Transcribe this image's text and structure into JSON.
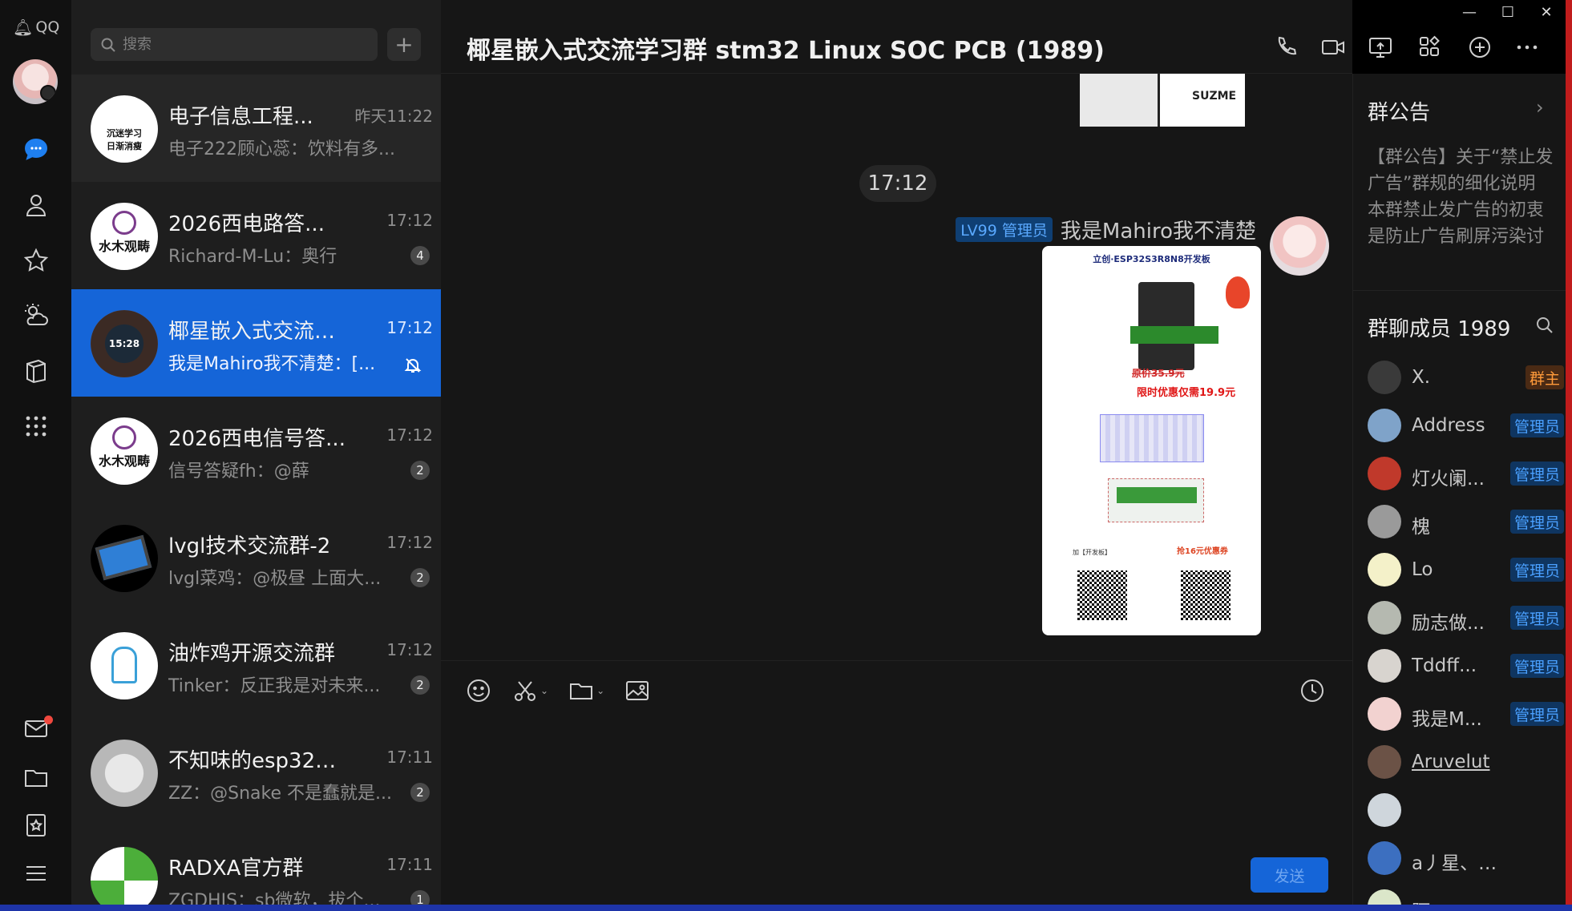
{
  "app": {
    "logo_text": "QQ"
  },
  "search": {
    "placeholder": "搜索"
  },
  "add_button": "+",
  "conversations": [
    {
      "name": "电子信息工程...",
      "time": "昨天11:22",
      "msg": "电子222顾心蕊：饮料有多...",
      "badge": "",
      "avatar_text": "沉迷学习\n日渐消瘦"
    },
    {
      "name": "2026西电路答...",
      "time": "17:12",
      "msg": "Richard-M-Lu：奥行",
      "badge": "4",
      "avatar_text": "水木观畴"
    },
    {
      "name": "椰星嵌入式交流学...",
      "time": "17:12",
      "msg": "我是Mahiro我不清楚：[...",
      "badge": "",
      "avatar_text": "15:28"
    },
    {
      "name": "2026西电信号答...",
      "time": "17:12",
      "msg": "信号答疑fh：@薛",
      "badge": "2",
      "avatar_text": "水木观畴"
    },
    {
      "name": "lvgl技术交流群-2",
      "time": "17:12",
      "msg": "lvgl菜鸡：@极昼 上面大...",
      "badge": "2",
      "avatar_text": ""
    },
    {
      "name": "油炸鸡开源交流群",
      "time": "17:12",
      "msg": "Tinker：反正我是对未来...",
      "badge": "2",
      "avatar_text": ""
    },
    {
      "name": "不知味的esp32唠...",
      "time": "17:11",
      "msg": "ZZ：@Snake 不是蠢就是...",
      "badge": "2",
      "avatar_text": ""
    },
    {
      "name": "RADXA官方群",
      "time": "17:11",
      "msg": "ZGDHJS：sb微软，拔个...",
      "badge": "1",
      "avatar_text": ""
    }
  ],
  "chat": {
    "title": "椰星嵌入式交流学习群 stm32 Linux SOC PCB (1989)",
    "time_divider": "17:12",
    "sender_level": "LV99 管理员",
    "sender_name": "我是Mahiro我不清楚",
    "sticker_text": "SUZME",
    "poster": {
      "title": "立创·ESP32S3R8N8开发板",
      "price_original": "原价35.9元",
      "price_sale": "限时优惠仅需19.9元",
      "footer_left": "加【开发板】",
      "footer_right": "抢16元优惠券"
    },
    "send_label": "发送"
  },
  "panel": {
    "announcement_title": "群公告",
    "announcement_body": "【群公告】关于“禁止发广告”群规的细化说明 本群禁止发广告的初衷是防止广告刷屏污染讨论环境。为...",
    "members_title": "群聊成员 1989",
    "members": [
      {
        "name": "X.",
        "role": "群主",
        "role_type": "owner",
        "color": "#3a3a3a"
      },
      {
        "name": "Address",
        "role": "管理员",
        "role_type": "admin",
        "color": "#7fa3c9"
      },
      {
        "name": "灯火阑...",
        "role": "管理员",
        "role_type": "admin",
        "color": "#c0392b"
      },
      {
        "name": "槐",
        "role": "管理员",
        "role_type": "admin",
        "color": "#9a9a9a"
      },
      {
        "name": "Lo",
        "role": "管理员",
        "role_type": "admin",
        "color": "#f4f1c9"
      },
      {
        "name": "励志做...",
        "role": "管理员",
        "role_type": "admin",
        "color": "#b5b9b0"
      },
      {
        "name": "Tddff...",
        "role": "管理员",
        "role_type": "admin",
        "color": "#d8d4cf"
      },
      {
        "name": "我是M...",
        "role": "管理员",
        "role_type": "admin",
        "color": "#f2d2d0"
      },
      {
        "name": "Aruvelut",
        "role": "",
        "role_type": "",
        "color": "#6b5246"
      },
      {
        "name": "",
        "role": "",
        "role_type": "",
        "color": "#cfd6dc"
      },
      {
        "name": "a丿星、丶心晨",
        "role": "",
        "role_type": "",
        "color": "#3c6fc0"
      },
      {
        "name": "阿",
        "role": "",
        "role_type": "",
        "color": "#dbe6c9"
      }
    ]
  },
  "colors": {
    "accent": "#1565d8",
    "owner_badge": "#ff9a3a",
    "admin_badge": "#4aa0ff"
  }
}
